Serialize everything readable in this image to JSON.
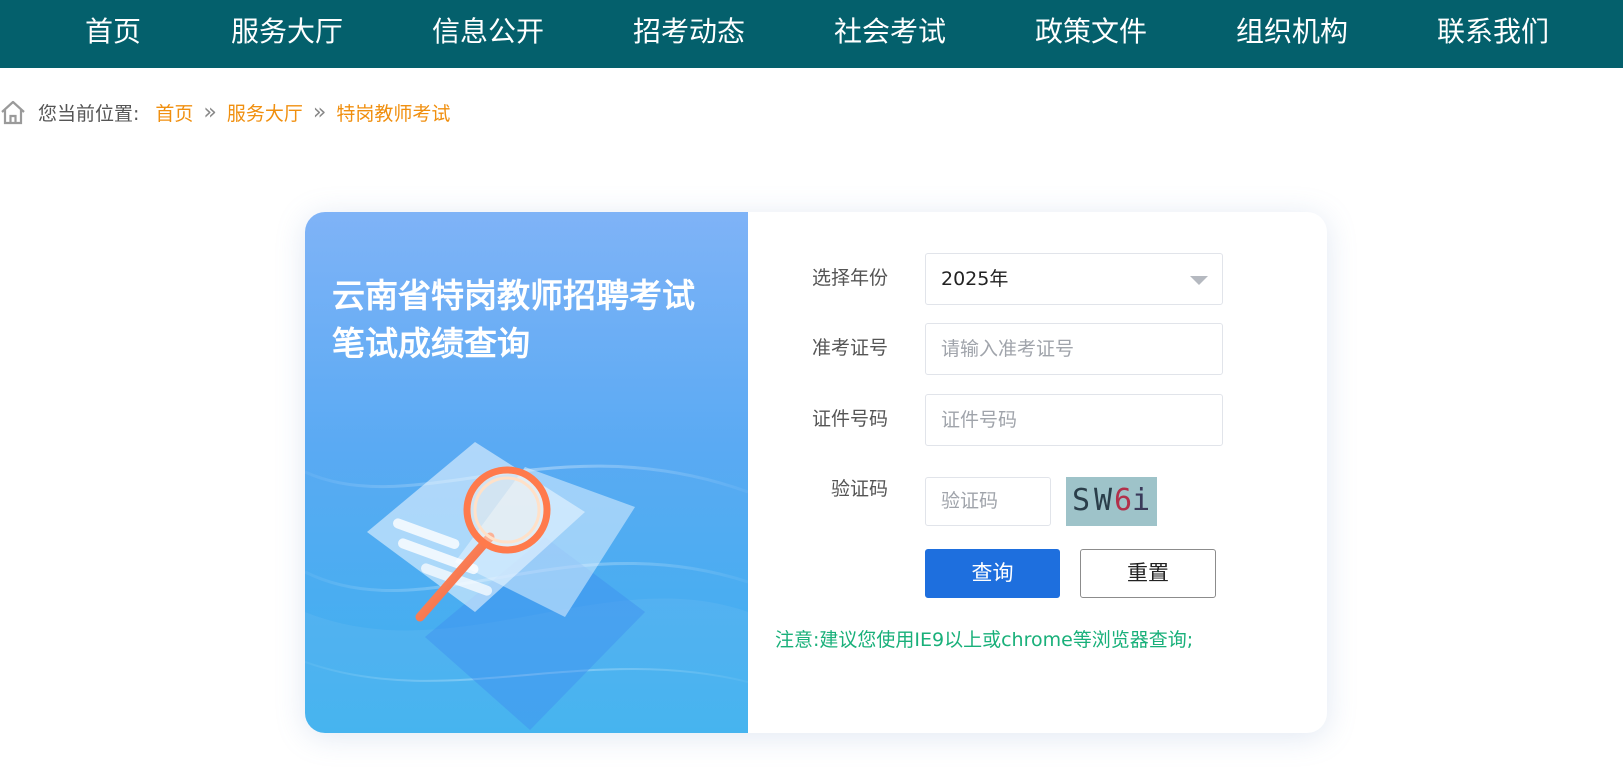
{
  "nav": {
    "items": [
      "首页",
      "服务大厅",
      "信息公开",
      "招考动态",
      "社会考试",
      "政策文件",
      "组织机构",
      "联系我们"
    ]
  },
  "breadcrumb": {
    "prefix": "您当前位置:",
    "links": [
      "首页",
      "服务大厅"
    ],
    "separator": "»",
    "current": "特岗教师考试"
  },
  "banner": {
    "title_line1": "云南省特岗教师招聘考试",
    "title_line2": "笔试成绩查询"
  },
  "form": {
    "year_label": "选择年份",
    "year_value": "2025年",
    "ticket_label": "准考证号",
    "ticket_placeholder": "请输入准考证号",
    "id_label": "证件号码",
    "id_placeholder": "证件号码",
    "captcha_label": "验证码",
    "captcha_placeholder": "验证码",
    "captcha_chars": [
      "S",
      "W",
      "6",
      "i"
    ],
    "query_button": "查询",
    "reset_button": "重置",
    "notice": "注意:建议您使用IE9以上或chrome等浏览器查询;"
  },
  "colors": {
    "nav_bg": "#04606c",
    "breadcrumb_link": "#f08f0f",
    "query_button": "#1e6fde",
    "notice_text": "#19b07a"
  },
  "icons": [
    "home-icon",
    "chevron-down-icon",
    "magnifier-illustration"
  ]
}
